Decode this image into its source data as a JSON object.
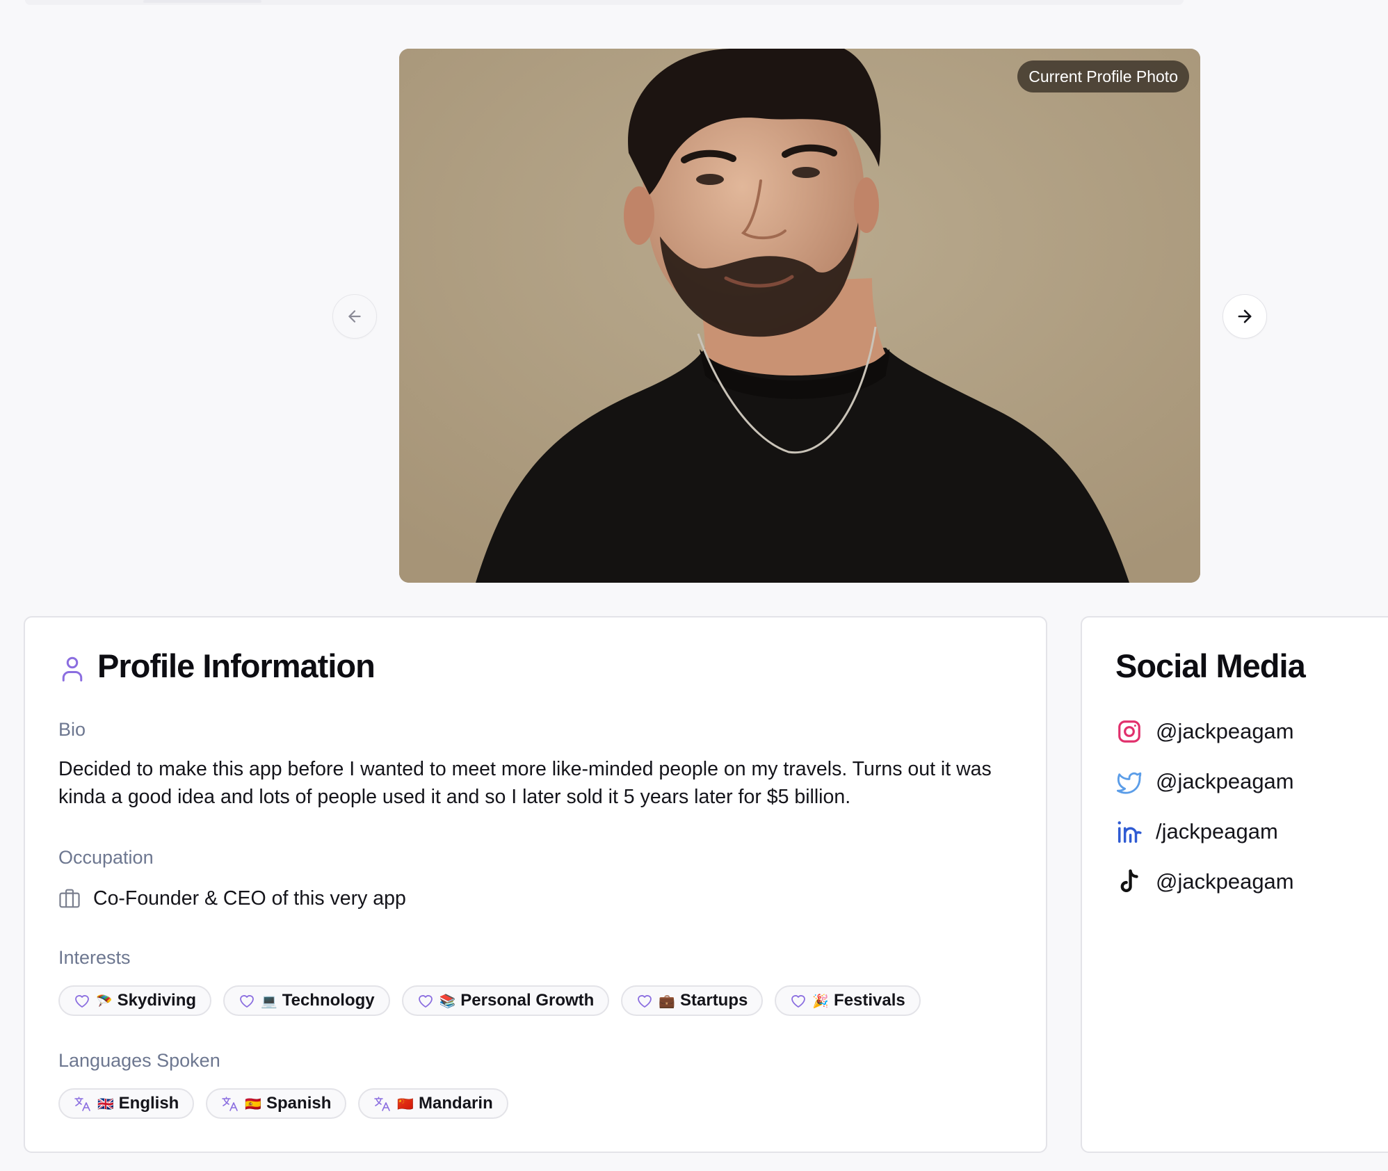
{
  "photo": {
    "badge": "Current Profile Photo"
  },
  "profile": {
    "title": "Profile Information",
    "bio_label": "Bio",
    "bio": "Decided to make this app before I wanted to meet more like-minded people on my travels. Turns out it was kinda a good idea and lots of people used it and so I later sold it 5 years later for $5 billion.",
    "occupation_label": "Occupation",
    "occupation": "Co-Founder & CEO of this very app",
    "interests_label": "Interests",
    "interests": [
      {
        "emoji": "🪂",
        "label": "Skydiving"
      },
      {
        "emoji": "💻",
        "label": "Technology"
      },
      {
        "emoji": "📚",
        "label": "Personal Growth"
      },
      {
        "emoji": "💼",
        "label": "Startups"
      },
      {
        "emoji": "🎉",
        "label": "Festivals"
      }
    ],
    "languages_label": "Languages Spoken",
    "languages": [
      {
        "emoji": "🇬🇧",
        "label": "English"
      },
      {
        "emoji": "🇪🇸",
        "label": "Spanish"
      },
      {
        "emoji": "🇨🇳",
        "label": "Mandarin"
      }
    ]
  },
  "social": {
    "title": "Social Media",
    "items": [
      {
        "icon": "instagram-icon",
        "handle": "@jackpeagam"
      },
      {
        "icon": "twitter-icon",
        "handle": "@jackpeagam"
      },
      {
        "icon": "linkedin-icon",
        "handle": "/jackpeagam"
      },
      {
        "icon": "tiktok-icon",
        "handle": "@jackpeagam"
      }
    ]
  },
  "colors": {
    "accent": "#8b6ee0",
    "label": "#6d7790",
    "instagram": "#e1306c",
    "twitter": "#5b9de8",
    "linkedin": "#2f5bd3"
  }
}
